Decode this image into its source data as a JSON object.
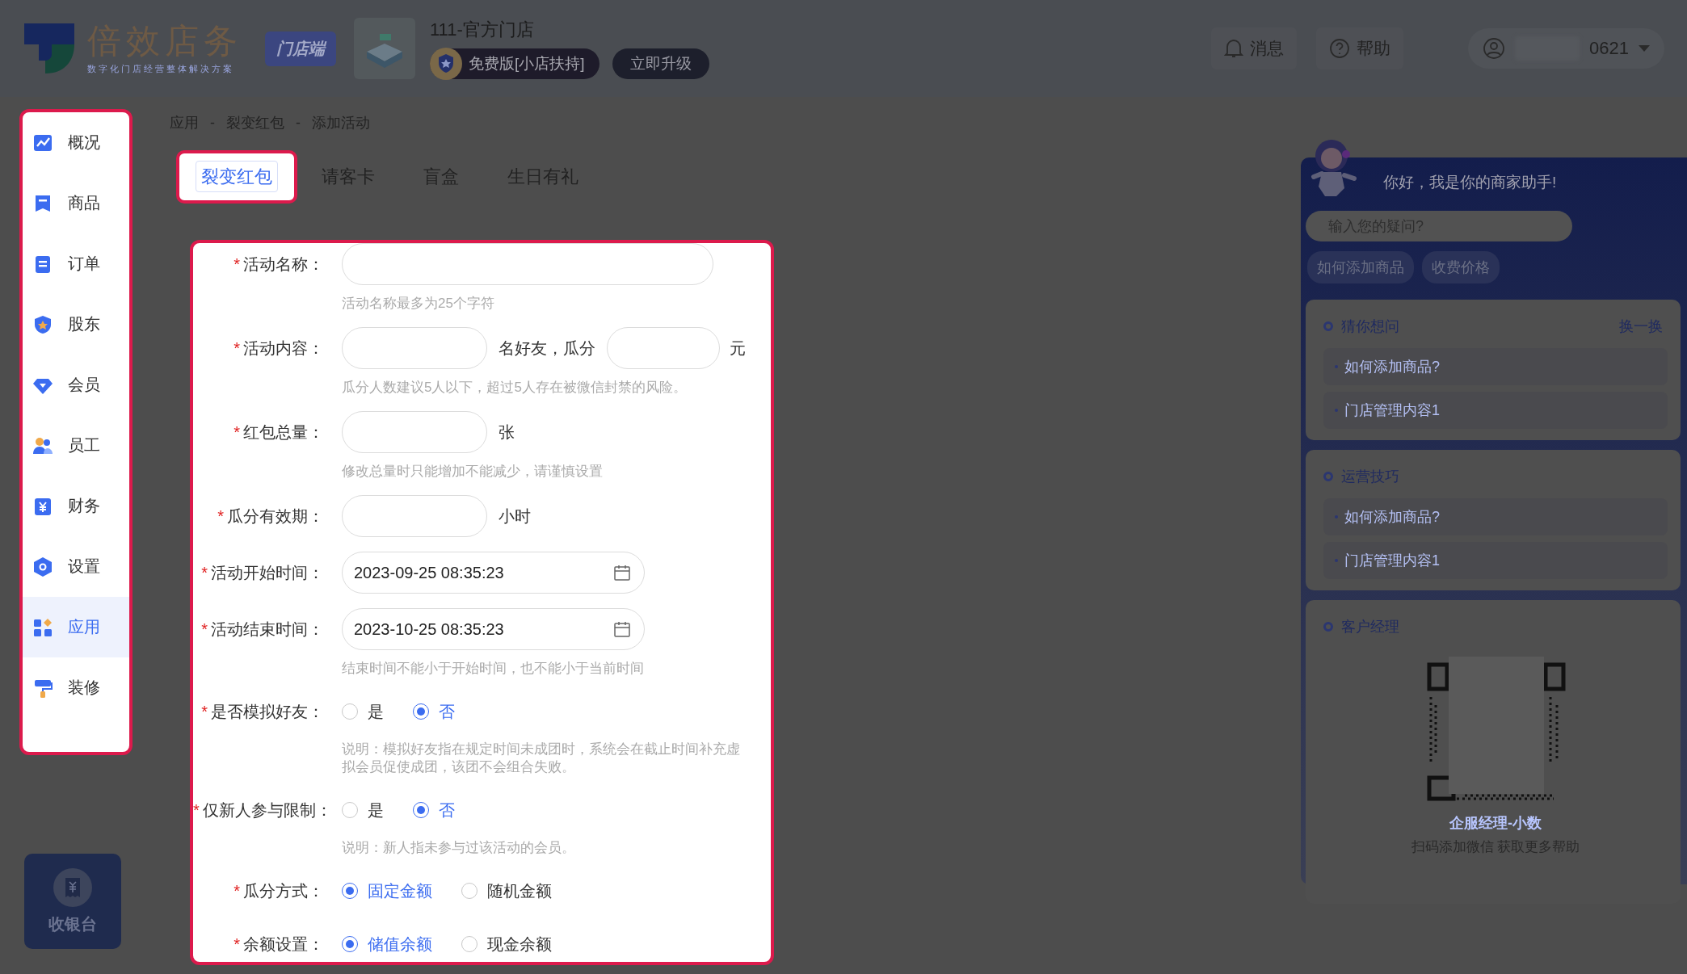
{
  "header": {
    "brand": {
      "name": "倍效店务",
      "tagline": "数字化门店经营整体解决方案"
    },
    "role_badge": "门店端",
    "store": {
      "name": "111-官方门店",
      "plan": "免费版[小店扶持]",
      "upgrade": "立即升级"
    },
    "actions": [
      {
        "label": "消息"
      },
      {
        "label": "帮助"
      }
    ],
    "user": {
      "name": "0621"
    }
  },
  "sidebar": {
    "items": [
      {
        "label": "概况",
        "selected": false
      },
      {
        "label": "商品",
        "selected": false
      },
      {
        "label": "订单",
        "selected": false
      },
      {
        "label": "股东",
        "selected": false
      },
      {
        "label": "会员",
        "selected": false
      },
      {
        "label": "员工",
        "selected": false
      },
      {
        "label": "财务",
        "selected": false
      },
      {
        "label": "设置",
        "selected": false
      },
      {
        "label": "应用",
        "selected": true
      },
      {
        "label": "装修",
        "selected": false
      }
    ],
    "cashier": "收银台"
  },
  "breadcrumb": {
    "items": [
      "应用",
      "裂变红包",
      "添加活动"
    ],
    "separator": "-"
  },
  "tabs": [
    {
      "label": "裂变红包",
      "selected": true
    },
    {
      "label": "请客卡",
      "selected": false
    },
    {
      "label": "盲盒",
      "selected": false
    },
    {
      "label": "生日有礼",
      "selected": false
    }
  ],
  "form": {
    "fields": [
      {
        "kind": "input",
        "mark": "*",
        "label": "活动名称：",
        "hint": "活动名称最多为25个字符"
      },
      {
        "kind": "split",
        "mark": "*",
        "label": "活动内容：",
        "middle": "名好友，瓜分",
        "unit": "元",
        "hint": "瓜分人数建议5人以下，超过5人存在被微信封禁的风险。"
      },
      {
        "kind": "unit",
        "mark": "*",
        "label": "红包总量：",
        "unit": "张",
        "hint": "修改总量时只能增加不能减少，请谨慎设置"
      },
      {
        "kind": "unit",
        "mark": "*",
        "label": "瓜分有效期：",
        "unit": "小时"
      },
      {
        "kind": "date",
        "mark": "*",
        "label": "活动开始时间：",
        "value": "2023-09-25 08:35:23"
      },
      {
        "kind": "date",
        "mark": "*",
        "label": "活动结束时间：",
        "value": "2023-10-25 08:35:23",
        "hint": "结束时间不能小于开始时间，也不能小于当前时间"
      },
      {
        "kind": "radio",
        "mark": "*",
        "label": "是否模拟好友：",
        "options": [
          {
            "label": "是",
            "selected": false
          },
          {
            "label": "否",
            "selected": true
          }
        ],
        "hint": "说明：模拟好友指在规定时间未成团时，系统会在截止时间补充虚拟会员促使成团，该团不会组合失败。"
      },
      {
        "kind": "radio",
        "mark": "*",
        "label": "仅新人参与限制：",
        "options": [
          {
            "label": "是",
            "selected": false
          },
          {
            "label": "否",
            "selected": true
          }
        ],
        "hint": "说明：新人指未参与过该活动的会员。"
      },
      {
        "kind": "radio",
        "mark": "*",
        "label": "瓜分方式：",
        "options": [
          {
            "label": "固定金额",
            "selected": true
          },
          {
            "label": "随机金额",
            "selected": false
          }
        ]
      },
      {
        "kind": "radio",
        "mark": "*",
        "label": "余额设置：",
        "options": [
          {
            "label": "储值余额",
            "selected": true
          },
          {
            "label": "现金余额",
            "selected": false
          }
        ]
      }
    ]
  },
  "assistant": {
    "greeting": "你好，我是你的商家助手!",
    "search": {
      "placeholder": "输入您的疑问?"
    },
    "chips": [
      "如何添加商品",
      "收费价格"
    ],
    "sections": [
      {
        "title": "猜你想问",
        "action": "换一换",
        "items": [
          "如何添加商品?",
          "门店管理内容1"
        ]
      },
      {
        "title": "运营技巧",
        "items": [
          "如何添加商品?",
          "门店管理内容1"
        ]
      }
    ],
    "manager": {
      "title": "客户经理",
      "name": "企服经理-小数",
      "caption": "扫码添加微信 获取更多帮助"
    }
  }
}
